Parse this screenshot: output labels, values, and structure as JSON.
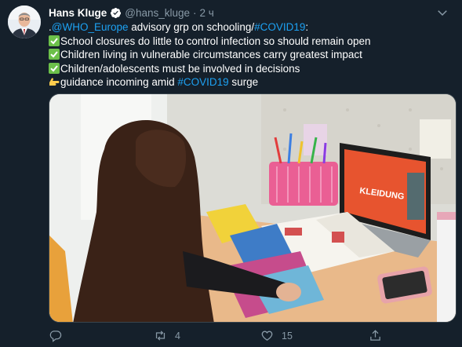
{
  "author": {
    "name": "Hans Kluge",
    "handle": "@hans_kluge",
    "separator": "·",
    "time": "2 ч"
  },
  "tweet": {
    "prefix": ".",
    "mention": "@WHO_Europe",
    "line1_text": " advisory grp on schooling/",
    "hashtag1": "#COVID19",
    "colon": ":",
    "point1": "School closures do little to control infection so should remain open",
    "point2": "Children living in vulnerable circumstances carry greatest impact",
    "point3": "Children/adolescents must be involved in decisions",
    "last_text": "guidance incoming amid ",
    "hashtag2": "#COVID19",
    "last_suffix": " surge"
  },
  "metrics": {
    "retweets": "4",
    "likes": "15"
  },
  "icons": {
    "verified": "verified-badge-icon",
    "caret": "chevron-down-icon",
    "check": "check-mark-emoji",
    "pointing": "pointing-hand-emoji",
    "reply": "reply-icon",
    "retweet": "retweet-icon",
    "like": "heart-icon",
    "share": "share-icon"
  },
  "colors": {
    "background": "#15202b",
    "link": "#1da1f2",
    "muted": "#8899a6",
    "check_green": "#6cc04a"
  },
  "media": {
    "laptop_screen_text": "KLEIDUNG"
  }
}
